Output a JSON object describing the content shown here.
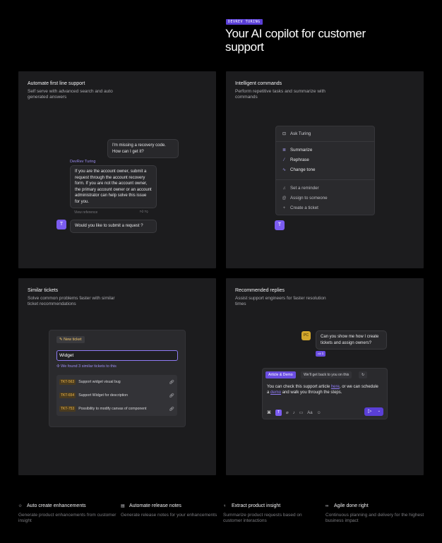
{
  "header": {
    "badge": "DEVREV TURING",
    "title": "Your AI copilot for customer support"
  },
  "cards": {
    "automate": {
      "title": "Automate first line support",
      "subtitle": "Self serve with advanced search and auto generated answers",
      "user_message": "I'm missing a recovery code. How can I get it?",
      "bot_name": "DevRev Turing",
      "bot_reply": "If you are the account owner, submit a request through the account recovery form. If you are not the account owner, the primary account owner or an account administrator can help solve this issue for you.",
      "view_reference": "View reference",
      "avatar_letter": "T",
      "bot_question": "Would you like to submit a request ?"
    },
    "commands": {
      "title": "Intelligent commands",
      "subtitle": "Perform repetitive tasks and summarize with commands",
      "menu_header": "Ask Turing",
      "primary_items": [
        {
          "label": "Summarize",
          "icon": "summarize-icon"
        },
        {
          "label": "Rephrase",
          "icon": "magic-wand-icon"
        },
        {
          "label": "Change tone",
          "icon": "wave-icon"
        }
      ],
      "secondary_items": [
        {
          "label": "Set a reminder",
          "icon": "bell-icon"
        },
        {
          "label": "Assign to someone",
          "icon": "at-icon"
        },
        {
          "label": "Create a ticket",
          "icon": "plus-icon"
        }
      ],
      "avatar_letter": "T"
    },
    "similar": {
      "title": "Similar tickets",
      "subtitle": "Solve common problems faster with similar ticket recommendations",
      "new_ticket_label": "New ticket",
      "search_value": "Widget",
      "found_text": "We found 3 similar tickets to this",
      "tickets": [
        {
          "id": "TKT-563",
          "title": "Support widget visual bug"
        },
        {
          "id": "TKT-654",
          "title": "Support Widget for description"
        },
        {
          "id": "TKT-753",
          "title": "Possibility to modify canvas of component"
        }
      ]
    },
    "replies": {
      "title": "Recommended replies",
      "subtitle": "Assist support engineers for faster resolution times",
      "user_initials": "PC",
      "customer_message": "Can you show me how I create tickets and assign owners?",
      "reaction_count": "1",
      "tab_active": "Article & Demo",
      "tab_other": "We'll get back to you on this",
      "reply_part1": "You can check this support article ",
      "reply_link1": "here",
      "reply_part2": ", or we can schedule a ",
      "reply_link2": "demo",
      "reply_part3": " and walk you through the steps.",
      "toolbar_text": "Aa"
    }
  },
  "features": [
    {
      "title": "Auto create enhancements",
      "desc": "Generate product enhancements from customer insight",
      "icon": "star-icon"
    },
    {
      "title": "Automate release notes",
      "desc": "Generate release notes for your enhancements",
      "icon": "notes-icon"
    },
    {
      "title": "Extract product insight",
      "desc": "Summarize product requests based on customer interactions",
      "icon": "bulb-icon"
    },
    {
      "title": "Agile done right",
      "desc": "Continuous planning and delivery for the highest business impact",
      "icon": "loop-icon"
    }
  ]
}
